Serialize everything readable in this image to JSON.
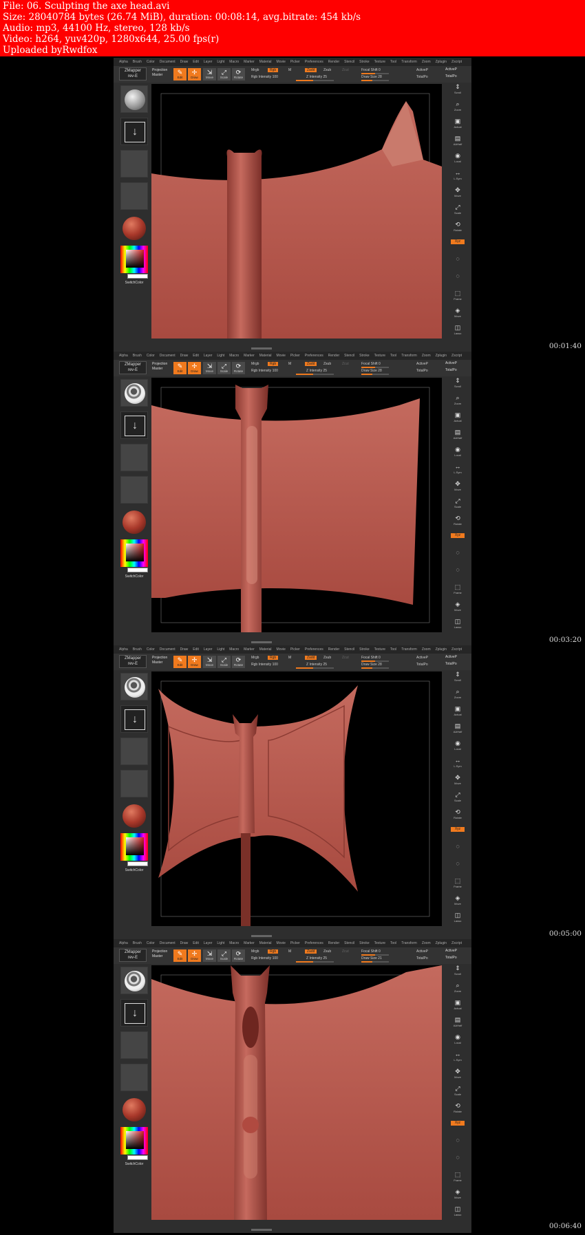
{
  "header": {
    "file": "File: 06. Sculpting the axe head.avi",
    "size": "Size: 28040784 bytes (26.74 MiB), duration: 00:08:14, avg.bitrate: 454 kb/s",
    "audio": "Audio: mp3, 44100 Hz, stereo, 128 kb/s",
    "video": "Video: h264, yuv420p, 1280x644, 25.00 fps(r)",
    "uploaded": "Uploaded byRwdfox"
  },
  "menu": [
    "Alpha",
    "Brush",
    "Color",
    "Document",
    "Draw",
    "Edit",
    "Layer",
    "Light",
    "Macro",
    "Marker",
    "Material",
    "Movie",
    "Picker",
    "Preferences",
    "Render",
    "Stencil",
    "Stroke",
    "Texture",
    "Tool",
    "Transform",
    "Zoom",
    "Zplugin",
    "Zscript"
  ],
  "toolbar": {
    "zmapper": "ZMapper",
    "zmapper_sub": "rev-E",
    "projection": "Projection",
    "master": "Master",
    "edit": "Edit",
    "draw": "Draw",
    "move": "Move",
    "scale": "Scale",
    "rotate": "Rotate",
    "mrgb": "Mrgb",
    "rgb_btn": "Rgb",
    "m": "M",
    "zadd": "Zadd",
    "zsub": "Zsub",
    "zcut": "Zcut",
    "focal_shift": "Focal Shift 0",
    "active_points": "ActiveP",
    "total_points": "TotalPo",
    "rgb_intensity": "Rgb  Intensity 100",
    "z_intensity": "Z Intensity 25"
  },
  "frames": [
    {
      "timestamp": "00:01:40",
      "draw_size": "Draw Size 28",
      "stage": 1
    },
    {
      "timestamp": "00:03:20",
      "draw_size": "Draw Size 28",
      "stage": 2
    },
    {
      "timestamp": "00:05:00",
      "draw_size": "Draw Size 28",
      "stage": 3
    },
    {
      "timestamp": "00:06:40",
      "draw_size": "Draw Size 21",
      "stage": 4
    }
  ],
  "left_panel": {
    "switch_color": "SwitchColor"
  },
  "right_panel": [
    "Scroll",
    "Zoom",
    "Actual",
    "AAHalf",
    "Local",
    "L.Sym",
    "Move",
    "Scale",
    "Rotate",
    "Xyz",
    "",
    "",
    "Frame",
    "Move",
    "Lasso"
  ],
  "colors": {
    "header_bg": "#ff0000",
    "accent": "#f07a1e",
    "clay": "#b5524a"
  }
}
